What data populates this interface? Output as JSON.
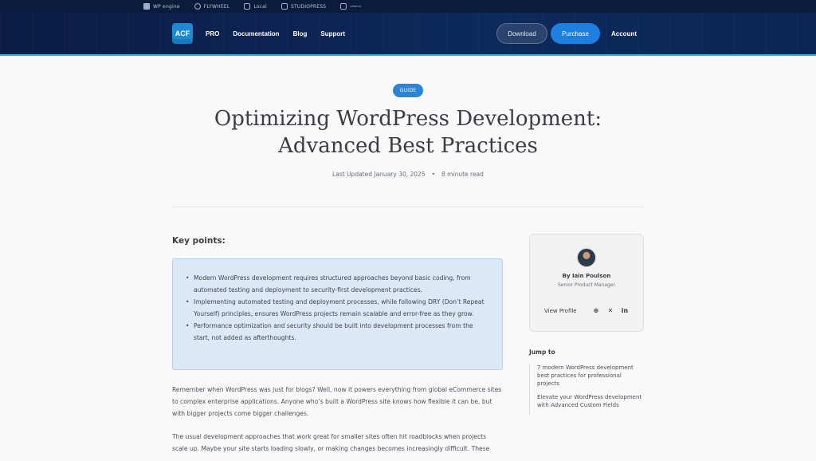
{
  "topbar": {
    "brands": [
      "WP engine",
      "FLYWHEEL",
      "Local",
      "STUDIOPRESS",
      "GENESIS"
    ]
  },
  "nav": {
    "logo": "ACF",
    "links": [
      "PRO",
      "Documentation",
      "Blog",
      "Support"
    ],
    "download": "Download",
    "purchase": "Purchase",
    "account": "Account"
  },
  "article": {
    "badge": "GUIDE",
    "title_line1": "Optimizing WordPress Development:",
    "title_line2": "Advanced Best Practices",
    "updated": "Last Updated January 30, 2025",
    "read_time": "8 minute read",
    "key_points_title": "Key points:",
    "key_points": [
      "Modern WordPress development requires structured approaches beyond basic coding, from automated testing and deployment to security-first development practices.",
      "Implementing automated testing and deployment processes, while following DRY (Don’t Repeat Yourself) principles, ensures WordPress projects remain scalable and error-free as they grow.",
      "Performance optimization and security should be built into development processes from the start, not added as afterthoughts."
    ],
    "para1": "Remember when WordPress was just for blogs? Well, now it powers everything from global eCommerce sites to complex enterprise applications. Anyone who’s built a WordPress site knows how flexible it can be, but with bigger projects come bigger challenges.",
    "para2": "The usual development approaches that work great for smaller sites often hit roadblocks when projects scale up. Maybe your site starts loading slowly, or making changes becomes increasingly difficult. These"
  },
  "author": {
    "name": "By Iain Poulson",
    "role": "Senior Product Manager",
    "view_profile": "View Profile",
    "socials": [
      "globe-icon",
      "x-icon",
      "linkedin-icon"
    ]
  },
  "jump": {
    "title": "Jump to",
    "items": [
      "7 modern WordPress development best practices for professional projects",
      "Elevate your WordPress development with Advanced Custom Fields"
    ]
  },
  "colors": {
    "nav_bg": "#0d2354",
    "accent": "#1d7fe0",
    "keybox_bg": "#dce8f7"
  }
}
